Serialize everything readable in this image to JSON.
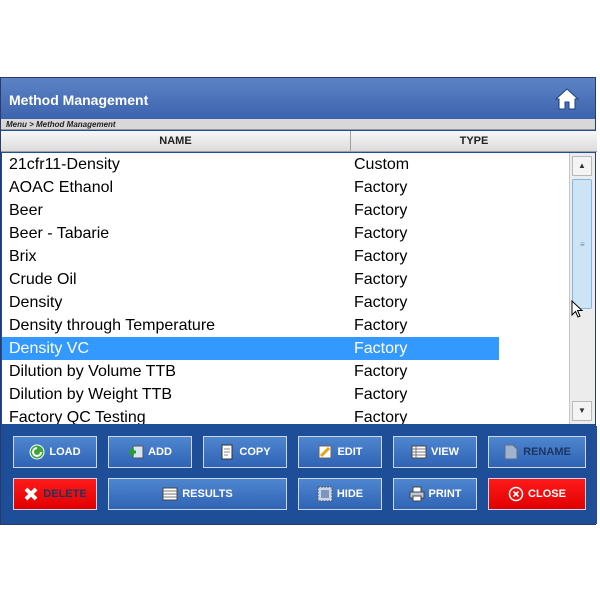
{
  "window": {
    "title": "Method Management",
    "breadcrumb": "Menu > Method Management"
  },
  "table": {
    "columns": [
      "NAME",
      "TYPE"
    ],
    "rows": [
      {
        "name": "21cfr11-Density",
        "type": "Custom"
      },
      {
        "name": "AOAC Ethanol",
        "type": "Factory"
      },
      {
        "name": "Beer",
        "type": "Factory"
      },
      {
        "name": "Beer - Tabarie",
        "type": "Factory"
      },
      {
        "name": "Brix",
        "type": "Factory"
      },
      {
        "name": "Crude Oil",
        "type": "Factory"
      },
      {
        "name": "Density",
        "type": "Factory"
      },
      {
        "name": "Density through Temperature",
        "type": "Factory"
      },
      {
        "name": "Density VC",
        "type": "Factory",
        "selected": true
      },
      {
        "name": "Dilution by Volume TTB",
        "type": "Factory"
      },
      {
        "name": "Dilution by Weight TTB",
        "type": "Factory"
      },
      {
        "name": "Factory QC Testing",
        "type": "Factory"
      }
    ]
  },
  "buttons": {
    "load": "LOAD",
    "add": "ADD",
    "copy": "COPY",
    "edit": "EDIT",
    "view": "VIEW",
    "rename": "RENAME",
    "delete": "DELETE",
    "results": "RESULTS",
    "hide": "HIDE",
    "print": "PRINT",
    "close": "CLOSE"
  },
  "icons": {
    "home": "home-icon",
    "load": "load-icon",
    "add": "add-icon",
    "copy": "copy-icon",
    "edit": "edit-icon",
    "view": "view-icon",
    "rename": "rename-icon",
    "delete": "delete-icon",
    "results": "results-icon",
    "hide": "hide-icon",
    "print": "print-icon",
    "close": "close-icon"
  },
  "colors": {
    "window_bg": "#1f4e99",
    "selected_row": "#3399ff",
    "danger": "#ff0000"
  }
}
